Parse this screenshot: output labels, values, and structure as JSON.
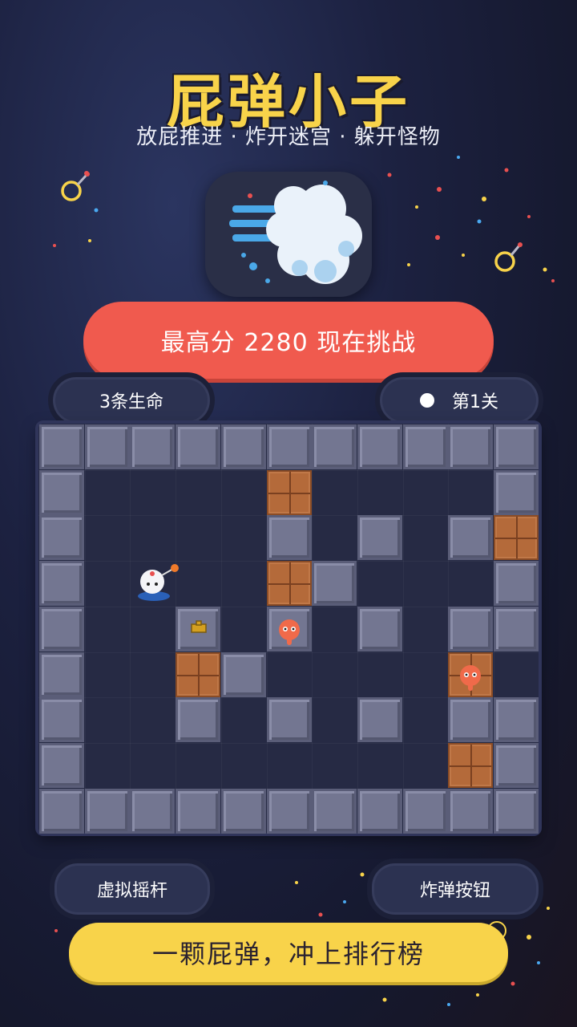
{
  "header": {
    "title": "屁弹小子",
    "subtitle": "放屁推进 · 炸开迷宫 · 躲开怪物"
  },
  "app_icon": {
    "name": "fart-cloud-icon"
  },
  "challenge_button": {
    "label": "最高分 2280  现在挑战"
  },
  "status": {
    "lives_label": "3条生命",
    "level_label": "第1关"
  },
  "board": {
    "cols": 11,
    "rows": 9,
    "grid": [
      "WWWWWWWWWWW",
      "W....C....W",
      "W....W.W.WC",
      "W....CW...W",
      "W..W.W.W.WW",
      "W..CW....C.",
      "W..W.W.W.WW",
      "W........CW",
      "WWWWWWWWWWW"
    ],
    "player": {
      "name": "fart-kid-player"
    },
    "monsters": 2,
    "pickup": "bomb-pickup"
  },
  "controls": {
    "joystick_label": "虚拟摇杆",
    "bomb_label": "炸弹按钮"
  },
  "banner": {
    "label": "一颗屁弹，冲上排行榜"
  },
  "colors": {
    "title": "#f8d34a",
    "challenge": "#f05a4e",
    "banner": "#f8d34a",
    "wall": "#737691",
    "crate": "#b46a3a",
    "floor": "#262a44"
  }
}
